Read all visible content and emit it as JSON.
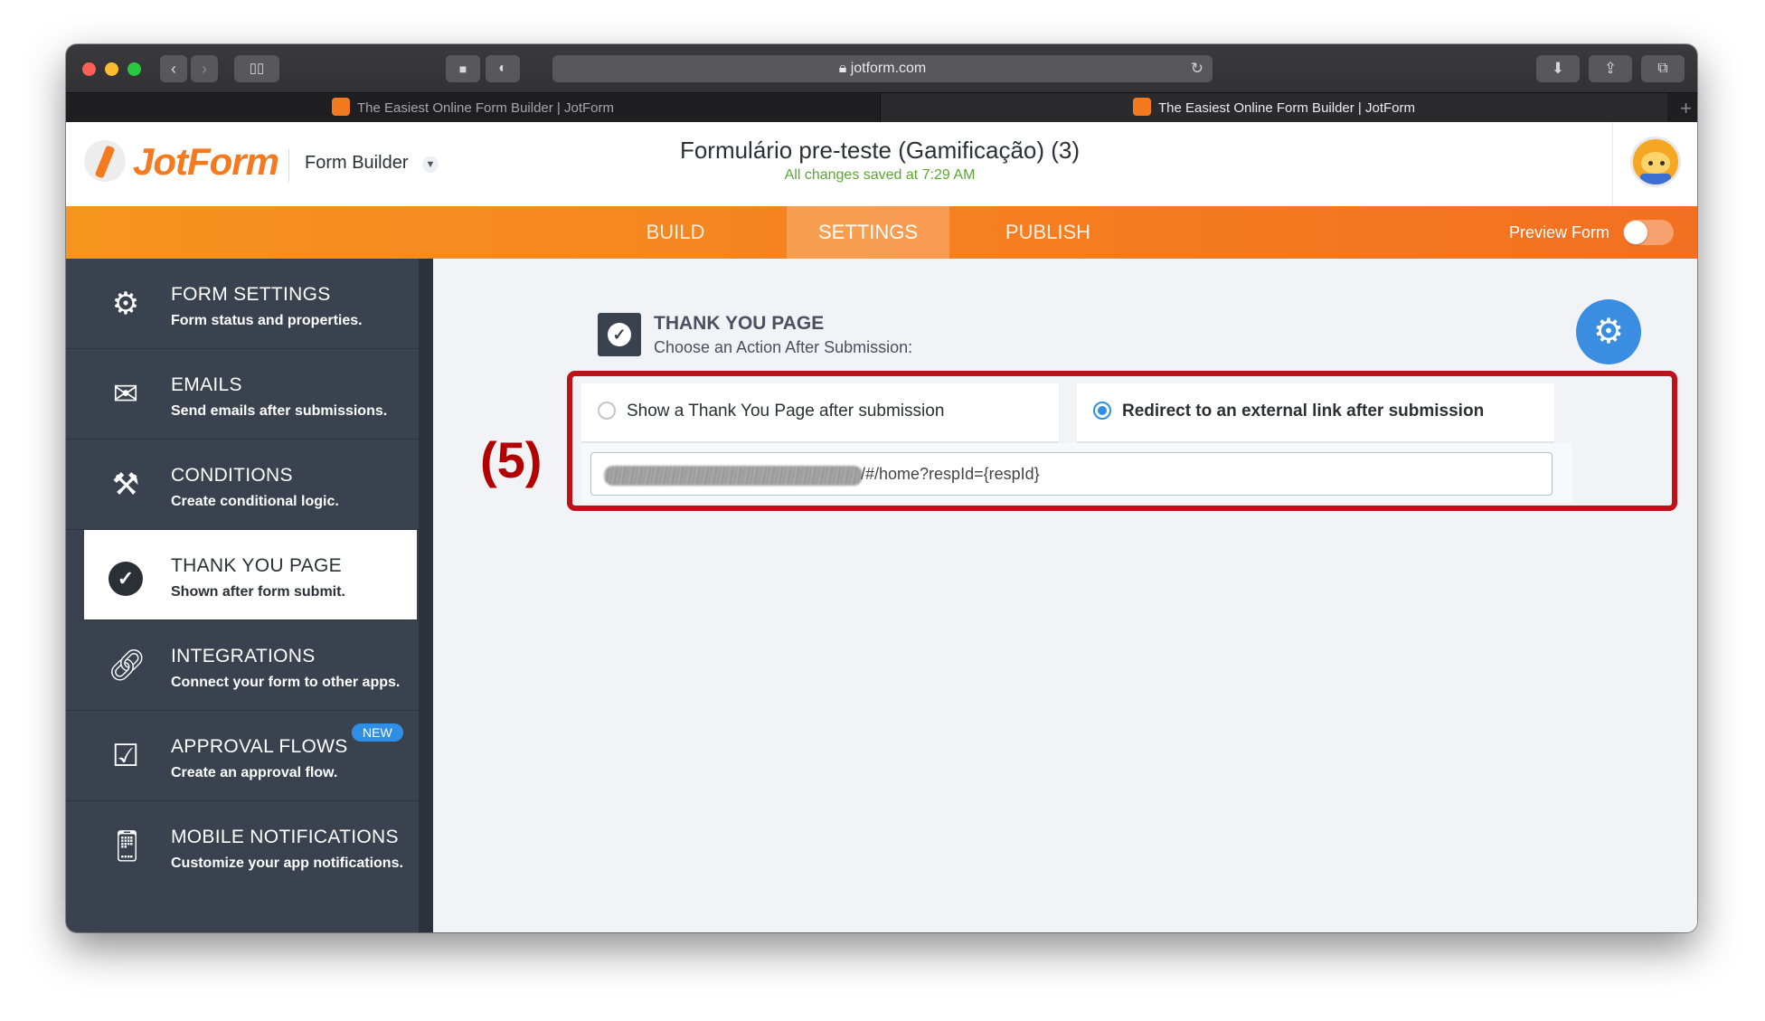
{
  "browser": {
    "url": "jotform.com",
    "tabs": [
      {
        "title": "The Easiest Online Form Builder | JotForm",
        "active": false
      },
      {
        "title": "The Easiest Online Form Builder | JotForm",
        "active": true
      }
    ]
  },
  "header": {
    "logo": "JotForm",
    "builder_label": "Form Builder",
    "form_title": "Formulário pre-teste (Gamificação) (3)",
    "save_status": "All changes saved at 7:29 AM"
  },
  "nav": {
    "tabs": [
      {
        "label": "BUILD",
        "active": false
      },
      {
        "label": "SETTINGS",
        "active": true
      },
      {
        "label": "PUBLISH",
        "active": false
      }
    ],
    "preview_label": "Preview Form",
    "preview_on": false,
    "accent": "#f58220"
  },
  "sidebar": {
    "items": [
      {
        "title": "FORM SETTINGS",
        "desc": "Form status and properties.",
        "icon": "gear-icon"
      },
      {
        "title": "EMAILS",
        "desc": "Send emails after submissions.",
        "icon": "envelope-icon"
      },
      {
        "title": "CONDITIONS",
        "desc": "Create conditional logic.",
        "icon": "tools-icon"
      },
      {
        "title": "THANK YOU PAGE",
        "desc": "Shown after form submit.",
        "icon": "check-circle-icon",
        "active": true
      },
      {
        "title": "INTEGRATIONS",
        "desc": "Connect your form to other apps.",
        "icon": "link-icon"
      },
      {
        "title": "APPROVAL FLOWS",
        "desc": "Create an approval flow.",
        "icon": "approval-icon",
        "badge": "NEW"
      },
      {
        "title": "MOBILE NOTIFICATIONS",
        "desc": "Customize your app notifications.",
        "icon": "mobile-notification-icon"
      }
    ]
  },
  "main": {
    "section_title": "THANK YOU PAGE",
    "section_subtitle": "Choose an Action After Submission:",
    "step_label": "(5)",
    "options": [
      {
        "label": "Show a Thank You Page after submission",
        "selected": false
      },
      {
        "label": "Redirect to an external link after submission",
        "selected": true
      }
    ],
    "redirect_url_visible": "/#/home?respId={respId}"
  }
}
